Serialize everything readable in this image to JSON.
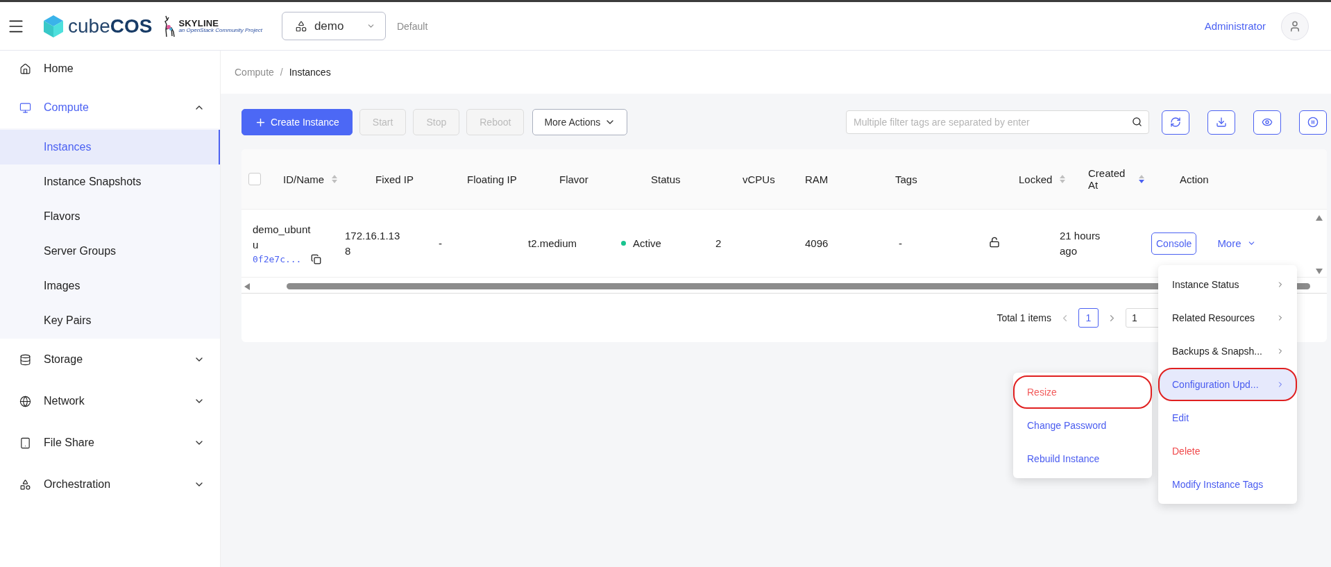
{
  "header": {
    "brand": {
      "light": "cube",
      "bold": "COS"
    },
    "partner": {
      "name": "SKYLINE",
      "tagline": "an OpenStack Community Project"
    },
    "project": {
      "value": "demo"
    },
    "domain": "Default",
    "user": "Administrator"
  },
  "sidebar": {
    "items": [
      {
        "label": "Home",
        "kind": "link",
        "selected": false
      },
      {
        "label": "Compute",
        "kind": "group",
        "selected": true,
        "expanded": true,
        "children": [
          {
            "label": "Instances",
            "selected": true
          },
          {
            "label": "Instance Snapshots",
            "selected": false
          },
          {
            "label": "Flavors",
            "selected": false
          },
          {
            "label": "Server Groups",
            "selected": false
          },
          {
            "label": "Images",
            "selected": false
          },
          {
            "label": "Key Pairs",
            "selected": false
          }
        ]
      },
      {
        "label": "Storage",
        "kind": "group",
        "selected": false,
        "expanded": false
      },
      {
        "label": "Network",
        "kind": "group",
        "selected": false,
        "expanded": false
      },
      {
        "label": "File Share",
        "kind": "group",
        "selected": false,
        "expanded": false
      },
      {
        "label": "Orchestration",
        "kind": "group",
        "selected": false,
        "expanded": false
      }
    ]
  },
  "breadcrumb": {
    "separator": "/",
    "items": [
      "Compute",
      "Instances"
    ]
  },
  "toolbar": {
    "buttons": [
      {
        "label": "Create Instance",
        "kind": "primary",
        "disabled": false
      },
      {
        "label": "Start",
        "kind": "plain",
        "disabled": true
      },
      {
        "label": "Stop",
        "kind": "plain",
        "disabled": true
      },
      {
        "label": "Reboot",
        "kind": "plain",
        "disabled": true
      },
      {
        "label": "More Actions",
        "kind": "dropdown",
        "disabled": false
      }
    ],
    "search": {
      "placeholder": "Multiple filter tags are separated by enter"
    }
  },
  "table": {
    "all_checked": false,
    "columns": [
      {
        "label": "ID/Name",
        "sortable": true,
        "sorted_desc": false
      },
      {
        "label": "Fixed IP"
      },
      {
        "label": "Floating IP"
      },
      {
        "label": "Flavor"
      },
      {
        "label": "Status"
      },
      {
        "label": "vCPUs"
      },
      {
        "label": "RAM"
      },
      {
        "label": "Tags"
      },
      {
        "label": "Locked",
        "sortable": true,
        "sorted_desc": false
      },
      {
        "label": "Created At",
        "sortable": true,
        "sorted_desc": true
      },
      {
        "label": "Action"
      }
    ],
    "rows": [
      {
        "name": "demo_ubuntu",
        "id": "0f2e7c...",
        "fixed_ip": "172.16.1.138",
        "floating_ip": "-",
        "flavor": "t2.medium",
        "status": {
          "label": "Active",
          "color": "#19c48f"
        },
        "vcpus": "2",
        "ram": "4096",
        "tags": "-",
        "locked": false,
        "created_at": "21 hours ago",
        "console": "Console",
        "more": "More"
      }
    ]
  },
  "pagination": {
    "total": "Total 1 items",
    "current": "1",
    "page_size": "1"
  },
  "more_menu": {
    "items": [
      {
        "label": "Instance Status",
        "kind": "submenu",
        "highlighted": false,
        "annotated": false
      },
      {
        "label": "Related Resources",
        "kind": "submenu",
        "highlighted": false,
        "annotated": false
      },
      {
        "label": "Backups & Snapsh...",
        "kind": "submenu",
        "highlighted": false,
        "annotated": false
      },
      {
        "label": "Configuration Upd...",
        "kind": "submenu",
        "highlighted": true,
        "annotated": true
      },
      {
        "label": "Edit",
        "kind": "action",
        "highlighted": false,
        "annotated": false
      },
      {
        "label": "Delete",
        "kind": "danger",
        "highlighted": false,
        "annotated": false
      },
      {
        "label": "Modify Instance Tags",
        "kind": "action",
        "highlighted": false,
        "annotated": false
      }
    ]
  },
  "submenu": {
    "items": [
      {
        "label": "Resize",
        "kind": "danger",
        "annotated": true
      },
      {
        "label": "Change Password",
        "kind": "action",
        "annotated": false
      },
      {
        "label": "Rebuild Instance",
        "kind": "action",
        "annotated": false
      }
    ]
  }
}
